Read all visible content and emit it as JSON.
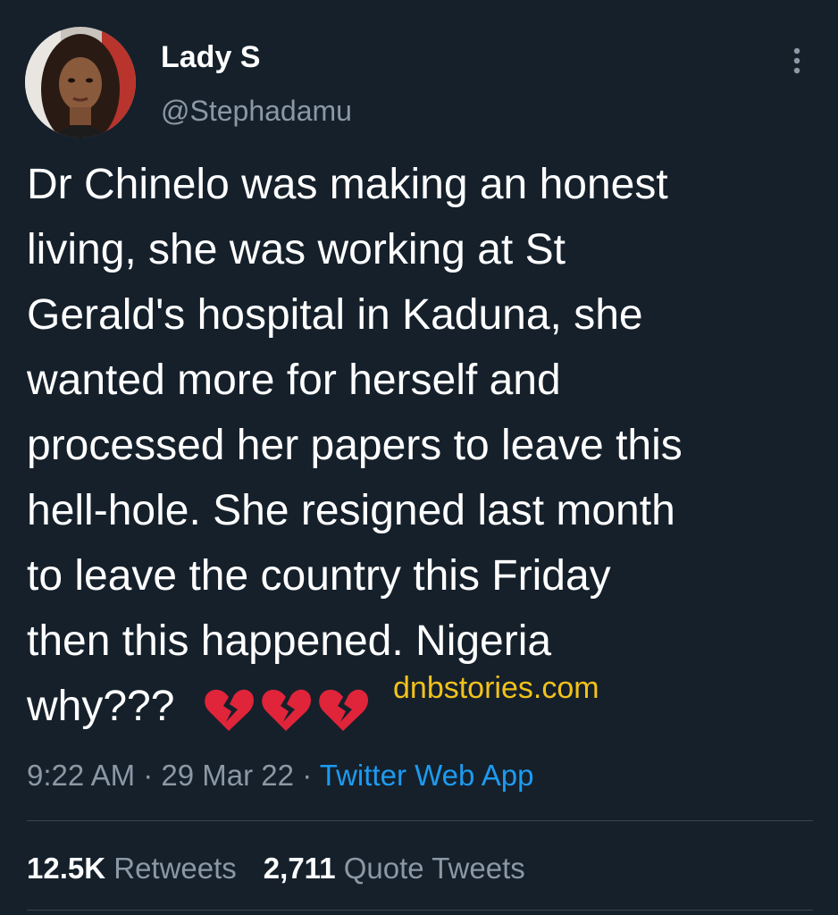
{
  "user": {
    "display_name": "Lady S",
    "handle": "@Stephadamu",
    "avatar_icon": "user-avatar"
  },
  "tweet": {
    "text": "Dr Chinelo was making an honest\nliving, she was working at St\nGerald's hospital in Kaduna, she\nwanted more for herself and\nprocessed her papers to leave this\nhell-hole. She resigned last month\nto leave the country this Friday\nthen this happened. Nigeria\nwhy???",
    "emoji": [
      "broken-heart-icon",
      "broken-heart-icon",
      "broken-heart-icon"
    ],
    "watermark": "dnbstories.com"
  },
  "meta": {
    "time": "9:22 AM",
    "separator": "·",
    "date": "29 Mar 22",
    "source": "Twitter Web App"
  },
  "stats": {
    "retweets_count": "12.5K",
    "retweets_label": "Retweets",
    "quotes_count": "2,711",
    "quotes_label": "Quote Tweets"
  },
  "colors": {
    "background": "#15202b",
    "secondary_text": "#8b98a5",
    "link": "#1d9bf0",
    "watermark": "#f2c21b",
    "heart": "#e0243a"
  },
  "icons": {
    "more": "more-vertical-icon"
  }
}
